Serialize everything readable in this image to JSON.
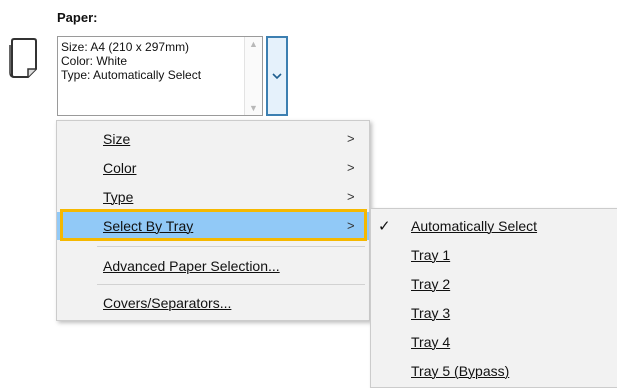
{
  "paper": {
    "section_label": "Paper:",
    "info_lines": [
      "Size: A4 (210 x 297mm)",
      "Color: White",
      "Type: Automatically Select"
    ]
  },
  "menu": {
    "items": [
      {
        "label": "Size",
        "has_submenu": true
      },
      {
        "label": "Color",
        "has_submenu": true
      },
      {
        "label": "Type",
        "has_submenu": true
      },
      {
        "label": "Select By Tray",
        "has_submenu": true,
        "highlighted": true
      },
      {
        "label": "Advanced Paper Selection...",
        "has_submenu": false
      },
      {
        "label": "Covers/Separators...",
        "has_submenu": false
      }
    ]
  },
  "submenu": {
    "items": [
      {
        "label": "Automatically Select",
        "checked": true
      },
      {
        "label": "Tray 1",
        "checked": false
      },
      {
        "label": "Tray 2",
        "checked": false
      },
      {
        "label": "Tray 3",
        "checked": false
      },
      {
        "label": "Tray 4",
        "checked": false
      },
      {
        "label": "Tray 5 (Bypass)",
        "checked": false
      }
    ]
  },
  "colors": {
    "highlight_bg": "#91c9f7",
    "highlight_outline": "#f5b800",
    "dropdown_border": "#3c7fb1"
  }
}
